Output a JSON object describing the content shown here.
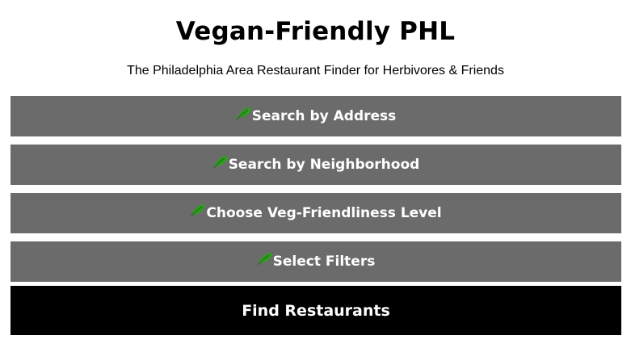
{
  "header": {
    "title": "Vegan-Friendly PHL",
    "subtitle": "The Philadelphia Area Restaurant Finder for Herbivores & Friends"
  },
  "sections": [
    {
      "label": "Search by Address",
      "icon": "leaf-icon"
    },
    {
      "label": "Search by Neighborhood",
      "icon": "leaf-icon"
    },
    {
      "label": "Choose Veg-Friendliness Level",
      "icon": "leaf-icon"
    },
    {
      "label": "Select Filters",
      "icon": "leaf-icon"
    }
  ],
  "find_button": {
    "label": "Find Restaurants"
  },
  "colors": {
    "section_bg": "#6b6b6b",
    "leaf": "#2e9e1f",
    "button_bg": "#000000",
    "text_light": "#ffffff"
  }
}
